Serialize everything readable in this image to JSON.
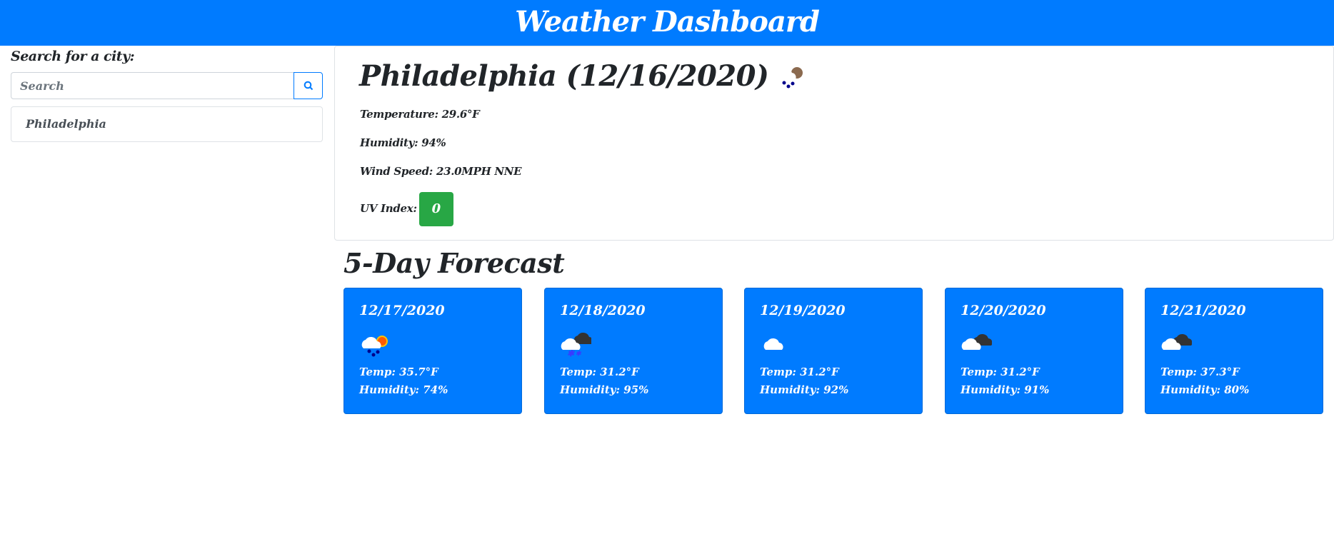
{
  "header": {
    "title": "Weather Dashboard"
  },
  "sidebar": {
    "label": "Search for a city:",
    "search_placeholder": "Search",
    "search_icon": "search-icon",
    "history": [
      "Philadelphia"
    ]
  },
  "current": {
    "title": "Philadelphia (12/16/2020)",
    "icon": "rain-night",
    "temperature": "Temperature: 29.6°F",
    "humidity": "Humidity: 94%",
    "wind": "Wind Speed: 23.0MPH NNE",
    "uv_label": "UV Index:",
    "uv_value": "0",
    "uv_color": "#28a745"
  },
  "forecast": {
    "title": "5-Day Forecast",
    "days": [
      {
        "date": "12/17/2020",
        "icon": "rain-sun",
        "temp": "Temp: 35.7°F",
        "humidity": "Humidity: 74%"
      },
      {
        "date": "12/18/2020",
        "icon": "snow-cloud",
        "temp": "Temp: 31.2°F",
        "humidity": "Humidity: 95%"
      },
      {
        "date": "12/19/2020",
        "icon": "cloud",
        "temp": "Temp: 31.2°F",
        "humidity": "Humidity: 92%"
      },
      {
        "date": "12/20/2020",
        "icon": "broken-clouds",
        "temp": "Temp: 31.2°F",
        "humidity": "Humidity: 91%"
      },
      {
        "date": "12/21/2020",
        "icon": "broken-clouds",
        "temp": "Temp: 37.3°F",
        "humidity": "Humidity: 80%"
      }
    ]
  },
  "colors": {
    "primary": "#007bff",
    "success": "#28a745"
  }
}
